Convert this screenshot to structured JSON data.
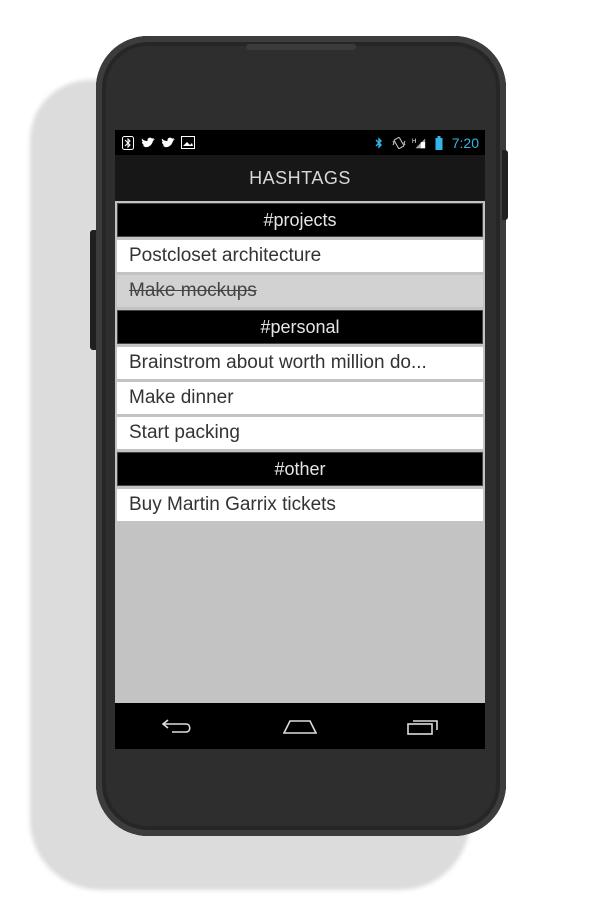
{
  "status_bar": {
    "left_icons": [
      "bluetooth-icon",
      "twitter-icon",
      "twitter-icon",
      "image-icon"
    ],
    "right_icons": [
      "bluetooth-icon",
      "vibrate-icon",
      "signal-h-icon",
      "battery-icon"
    ],
    "time": "7:20"
  },
  "action_bar": {
    "title": "HASHTAGS"
  },
  "sections": [
    {
      "header": "#projects",
      "items": [
        {
          "text": "Postcloset architecture",
          "done": false
        },
        {
          "text": "Make mockups",
          "done": true
        }
      ]
    },
    {
      "header": "#personal",
      "items": [
        {
          "text": "Brainstrom about worth million do...",
          "done": false
        },
        {
          "text": "Make dinner",
          "done": false
        },
        {
          "text": "Start packing",
          "done": false
        }
      ]
    },
    {
      "header": "#other",
      "items": [
        {
          "text": "Buy Martin Garrix tickets",
          "done": false
        }
      ]
    }
  ],
  "nav_bar": {
    "buttons": [
      "back-icon",
      "home-icon",
      "recents-icon"
    ]
  },
  "colors": {
    "clock": "#33b5e5",
    "header_bg": "#000000",
    "item_bg": "#ffffff",
    "done_bg": "#d2d2d2",
    "screen_bg": "#c3c3c3"
  }
}
